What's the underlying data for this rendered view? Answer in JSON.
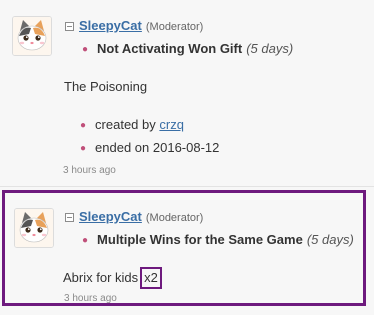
{
  "posts": [
    {
      "username": "SleepyCat",
      "role": "(Moderator)",
      "game_title": "Not Activating Won Gift",
      "duration": "(5 days)",
      "body": "The Poisoning",
      "created_prefix": "created by ",
      "creator": "crzq",
      "ended": "ended on 2016-08-12",
      "timestamp": "3 hours ago"
    },
    {
      "username": "SleepyCat",
      "role": "(Moderator)",
      "game_title": "Multiple Wins for the Same Game",
      "duration": "(5 days)",
      "body": "Abrix for kids",
      "body_highlight": "x2",
      "timestamp": "3 hours ago"
    }
  ],
  "icons": {
    "collapse": "collapse-icon",
    "avatar": "cat-avatar",
    "bullet": "bullet-icon"
  },
  "colors": {
    "link": "#3a6ea5",
    "bullet": "#c0507a",
    "highlight_border": "#6e1a7e"
  }
}
